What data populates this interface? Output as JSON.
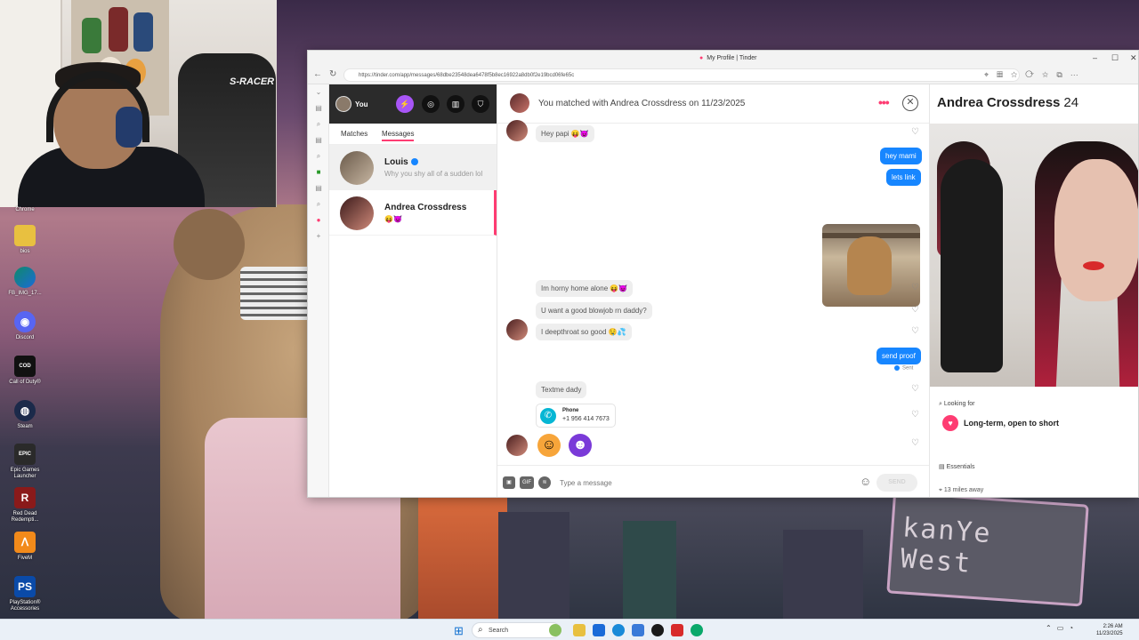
{
  "browser": {
    "title": "My Profile | Tinder",
    "url": "https://tinder.com/app/messages/68dbe23548dea6478f5b8ec16922a8db0f2e19bcd06fe65c"
  },
  "tinder": {
    "you_label": "You",
    "tabs": {
      "matches": "Matches",
      "messages": "Messages"
    },
    "conversations": [
      {
        "name": "Louis",
        "preview": "Why you shy all of a sudden lol",
        "verified": true
      },
      {
        "name": "Andrea Crossdress",
        "preview": "😝😈"
      }
    ]
  },
  "chat": {
    "header": "You matched with Andrea Crossdress on 11/23/2025",
    "messages": {
      "m1": "Hey papi 😝😈",
      "m2": "hey mami",
      "m3": "lets link",
      "m4": "Im horny home alone 😝😈",
      "m5": "U want a good blowjob rn daddy?",
      "m6": "I deepthroat so good 🤤💦",
      "m7": "send proof",
      "m8": "Sent",
      "m9": "Textme dady"
    },
    "phone_card": {
      "label": "Phone",
      "number": "+1 956 414 7673"
    },
    "composer": {
      "placeholder": "Type a message",
      "send_label": "SEND",
      "gif_label": "GIF"
    }
  },
  "profile": {
    "name": "Andrea Crossdress",
    "age": "24",
    "looking_for_label": "Looking for",
    "looking_for_value": "Long-term, open to short",
    "essentials_label": "Essentials",
    "distance": "13 miles away"
  },
  "webcam": {
    "chair_brand": "S-RACER"
  },
  "desktop_icons": [
    {
      "label": "Chrome"
    },
    {
      "label": "bios"
    },
    {
      "label": "FB_IMG_17..."
    },
    {
      "label": "Discord"
    },
    {
      "label": "Call of Duty®"
    },
    {
      "label": "Steam"
    },
    {
      "label": "Epic Games Launcher"
    },
    {
      "label": "Red Dead Redempti..."
    },
    {
      "label": "FiveM"
    },
    {
      "label": "PlayStation® Accessories"
    }
  ],
  "wallpaper": {
    "sign_text": "kanYe West"
  },
  "taskbar": {
    "search_label": "Search",
    "time": "2:26 AM",
    "date": "11/23/2025"
  },
  "colors": {
    "tinder_accent": "#fe3c72",
    "outgoing_bubble": "#1786ff",
    "incoming_bubble": "#eeeeee"
  }
}
